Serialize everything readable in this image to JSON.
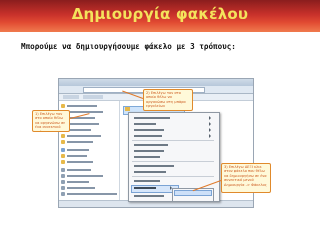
{
  "slide": {
    "title": "Δημιουργία φακέλου",
    "subtitle": "Μπορούμε να δημιουργήσουμε φάκελο με 3 τρόπους:"
  },
  "callouts": [
    "1) Επιλέγω τον στο οποίο θέλω να οργανώσω σε ένα συνεκτικό τρόπο Δημιουργία -> Φάκελος",
    "2) Επιλέγω τον στο οποίο θέλω να οργανώσω στη μπάρα εργαλείων",
    "3) Επιλέγω ΔΕΞΙ κλικ στον φάκελο που θέλω να δημιουργήσω σε ένα συνεκτικό μενού Δημιουργία -> Φάκελος"
  ],
  "colors": {
    "title_gradient_top": "#8a1d1d",
    "title_gradient_bottom": "#f07a4e",
    "title_text": "#f4e35c",
    "callout_border": "#e08a2c",
    "callout_text": "#cc5a1e"
  }
}
